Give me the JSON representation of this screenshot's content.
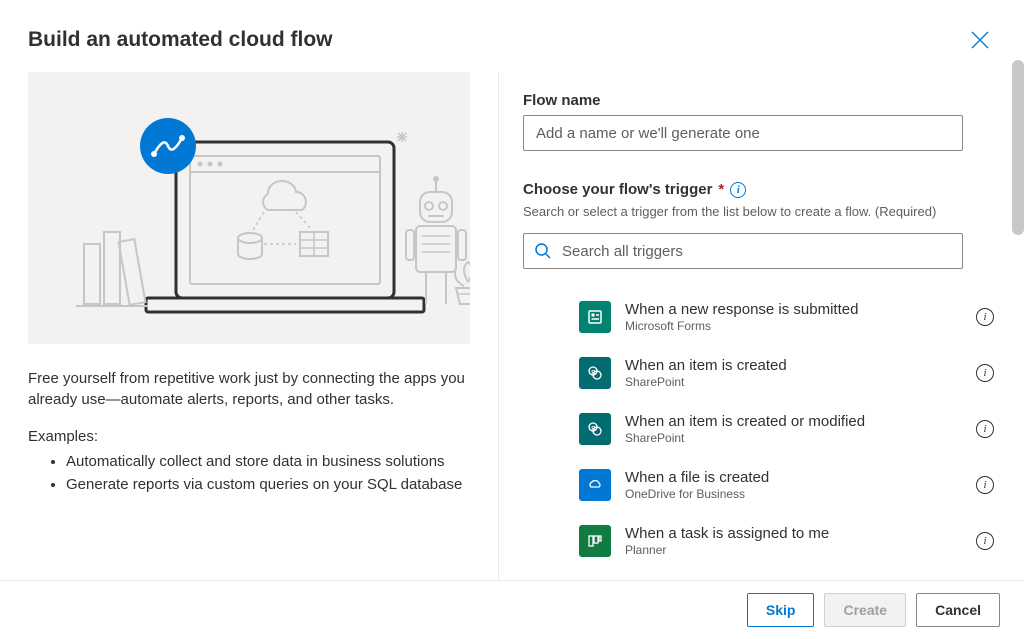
{
  "header": {
    "title": "Build an automated cloud flow"
  },
  "left": {
    "description": "Free yourself from repetitive work just by connecting the apps you already use—automate alerts, reports, and other tasks.",
    "examples_label": "Examples:",
    "examples": [
      "Automatically collect and store data in business solutions",
      "Generate reports via custom queries on your SQL database"
    ]
  },
  "right": {
    "flow_name_label": "Flow name",
    "flow_name_placeholder": "Add a name or we'll generate one",
    "trigger_label": "Choose your flow's trigger",
    "trigger_sublabel": "Search or select a trigger from the list below to create a flow. (Required)",
    "search_placeholder": "Search all triggers",
    "triggers": [
      {
        "title": "When a new response is submitted",
        "connector": "Microsoft Forms",
        "icon": "forms-icon",
        "bg": "#028372"
      },
      {
        "title": "When an item is created",
        "connector": "SharePoint",
        "icon": "sharepoint-icon",
        "bg": "#036c70"
      },
      {
        "title": "When an item is created or modified",
        "connector": "SharePoint",
        "icon": "sharepoint-icon",
        "bg": "#036c70"
      },
      {
        "title": "When a file is created",
        "connector": "OneDrive for Business",
        "icon": "onedrive-icon",
        "bg": "#0078d4"
      },
      {
        "title": "When a task is assigned to me",
        "connector": "Planner",
        "icon": "planner-icon",
        "bg": "#107c41"
      }
    ]
  },
  "footer": {
    "skip": "Skip",
    "create": "Create",
    "cancel": "Cancel"
  }
}
